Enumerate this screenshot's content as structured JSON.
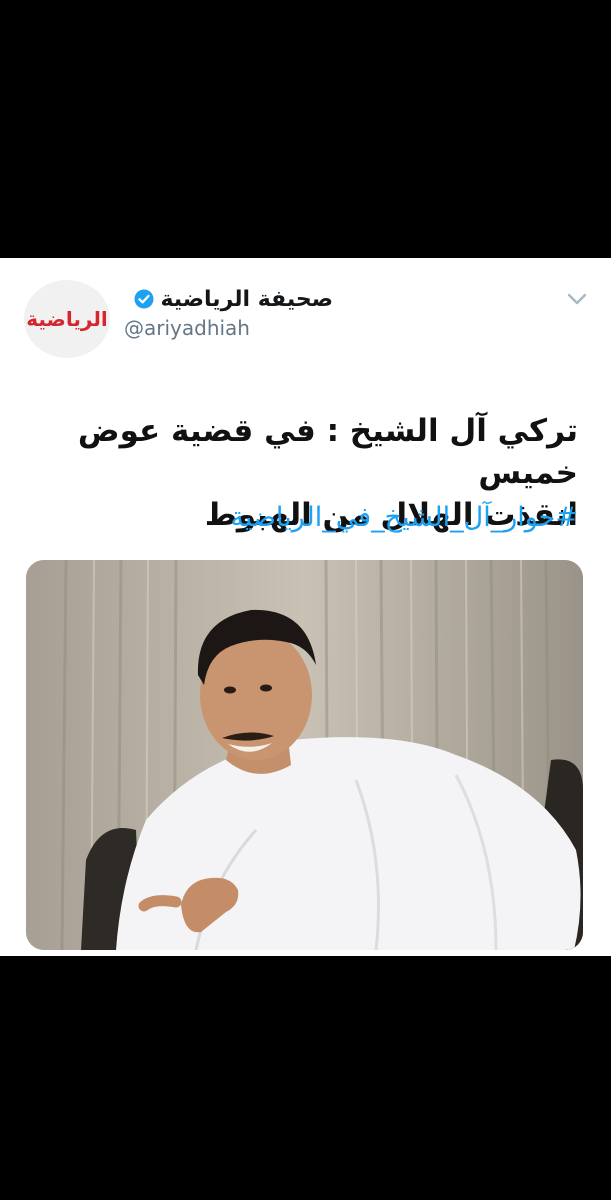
{
  "tweet": {
    "author_name": "صحيفة الرياضية",
    "handle": "@ariyadhiah",
    "avatar_logo_text": "الرياضية",
    "text_line1": "تركي آل الشيخ : في قضية عوض خميس",
    "text_line2": "انقذت الهلال من الهبوط",
    "hashtag": "#حوار_آل_الشيخ_في_الرياضية",
    "verified": true
  },
  "colors": {
    "background": "#000000",
    "card": "#ffffff",
    "link": "#1da1f2",
    "handle": "#657786",
    "verified_badge": "#1da1f2",
    "logo_red": "#d3262e"
  },
  "icons": {
    "verified": "verified-badge-icon",
    "menu": "chevron-down-icon"
  }
}
